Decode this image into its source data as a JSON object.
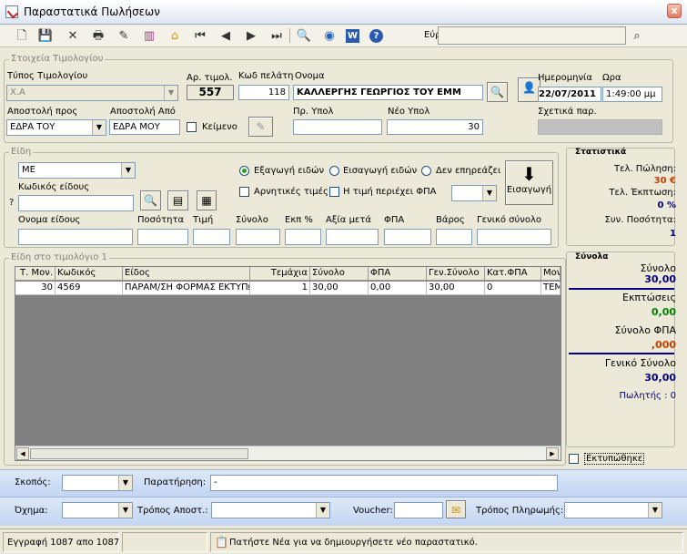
{
  "window": {
    "title": "Παραστατικά Πωλήσεων",
    "close_label": "x"
  },
  "toolbar": {
    "search_label": "Εύρεση",
    "search_value": ""
  },
  "invoice": {
    "group_title": "Στοιχεία Τιμολογίου",
    "type_label": "Τύπος Τιμολογίου",
    "type_value": "Χ.Α",
    "number_label": "Αρ. τιμολ.",
    "number_value": "557",
    "customer_code_label": "Κωδ πελάτη",
    "customer_code_value": "118",
    "name_label": "Ονομα",
    "name_value": "ΚΑΛΛΕΡΓΗΣ ΓΕΩΡΓΙΟΣ ΤΟΥ ΕΜΜ",
    "date_label": "Ημερομηνία",
    "date_value": "22/07/2011",
    "time_label": "Ωρα",
    "time_value": "1:49:00 μμ",
    "ship_to_label": "Αποστολή προς",
    "ship_to_value": "ΕΔΡΑ ΤΟΥ",
    "ship_from_label": "Αποστολή Από",
    "ship_from_value": "ΕΔΡΑ ΜΟΥ",
    "text_label": "Κείμενο",
    "prev_balance_label": "Πρ. Υπολ",
    "prev_balance_value": "",
    "new_balance_label": "Νέο Υπολ",
    "new_balance_value": "30",
    "related_label": "Σχετικά παρ.",
    "related_value": ""
  },
  "items": {
    "group_title": "Είδη",
    "category_value": "ΜΕ",
    "code_label": "Κωδικός είδους",
    "code_value": "",
    "question_mark": "?",
    "export_label": "Εξαγωγή ειδών",
    "import_label": "Εισαγωγή ειδών",
    "noaffect_label": "Δεν επηρεάζει",
    "negative_label": "Αρνητικές τιμές",
    "includes_vat_label": "Η τιμή περιέχει ΦΠΑ",
    "insert_button_label": "Εισαγωγή",
    "columns": [
      "Ονομα είδους",
      "Ποσότητα",
      "Τιμή",
      "Σύνολο",
      "Εκπ %",
      "Αξία μετά",
      "ΦΠΑ",
      "Βάρος",
      "Γενικό σύνολο"
    ]
  },
  "grid": {
    "group_title": "Είδη στο τιμολόγιο 1",
    "headers": [
      "Τ. Μον.",
      "Κωδικός",
      "Είδος",
      "Τεμάχια",
      "Σύνολο",
      "ΦΠΑ",
      "Γεν.Σύνολο",
      "Κατ.ΦΠΑ",
      "Μον"
    ],
    "rows": [
      [
        "30",
        "4569",
        "ΠΑΡΑΜ/ΣΗ ΦΟΡΜΑΣ ΕΚΤΥΠΩ",
        "1",
        "30,00",
        "0,00",
        "30,00",
        "0",
        "ΤΕΜ"
      ]
    ]
  },
  "stats": {
    "title": "Στατιστικά",
    "last_sale_label": "Τελ. Πώληση:",
    "last_sale_value": "30 €",
    "last_discount_label": "Τελ. Έκπτωση:",
    "last_discount_value": "0 %",
    "total_qty_label": "Συν. Ποσότητα:",
    "total_qty_value": "1"
  },
  "totals": {
    "title": "Σύνολα",
    "sum_label": "Σύνολο",
    "sum_value": "30,00",
    "discounts_label": "Εκπτώσεις",
    "discounts_value": "0,00",
    "vat_label": "Σύνολο ΦΠΑ",
    "vat_value": ",000",
    "grand_label": "Γενικό Σύνολο",
    "grand_value": "30,00",
    "salesman_label": "Πωλητής : 0",
    "printed_label": "Εκτυπώθηκε"
  },
  "footer": {
    "purpose_label": "Σκοπός:",
    "purpose_value": "",
    "note_label": "Παρατήρηση:",
    "note_value": "-",
    "vehicle_label": "Όχημα:",
    "vehicle_value": "",
    "ship_method_label": "Τρόπος Αποστ.:",
    "ship_method_value": "",
    "voucher_label": "Voucher:",
    "voucher_value": "",
    "payment_label": "Τρόπος Πληρωμής:",
    "payment_value": ""
  },
  "status": {
    "record_text": "Εγγραφή 1087 απο 1087",
    "hint_text": "Πατήστε Νέα για να δημιουργήσετε νέο παραστατικό."
  },
  "colors": {
    "accent_red": "#c04000",
    "accent_green": "#008000",
    "accent_blue": "#000080"
  }
}
